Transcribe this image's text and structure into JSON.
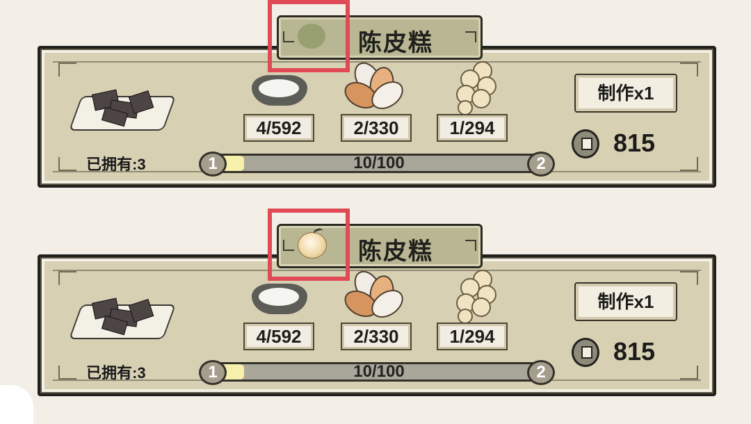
{
  "cards": [
    {
      "title": "陈皮糕",
      "owned": "已拥有:3",
      "ingredients": [
        "4/592",
        "2/330",
        "1/294"
      ],
      "progress": {
        "text": "10/100",
        "fraction": 0.1,
        "start_level": "1",
        "end_level": "2"
      },
      "action": "制作x1",
      "cost": "815",
      "tab_icon": "muted-round-icon"
    },
    {
      "title": "陈皮糕",
      "owned": "已拥有:3",
      "ingredients": [
        "4/592",
        "2/330",
        "1/294"
      ],
      "progress": {
        "text": "10/100",
        "fraction": 0.1,
        "start_level": "1",
        "end_level": "2"
      },
      "action": "制作x1",
      "cost": "815",
      "tab_icon": "glowing-orb-icon"
    }
  ],
  "colors": {
    "highlight": "#e04a57",
    "panel": "#d8d0b3",
    "progress_fill": "#f7f0ac"
  }
}
